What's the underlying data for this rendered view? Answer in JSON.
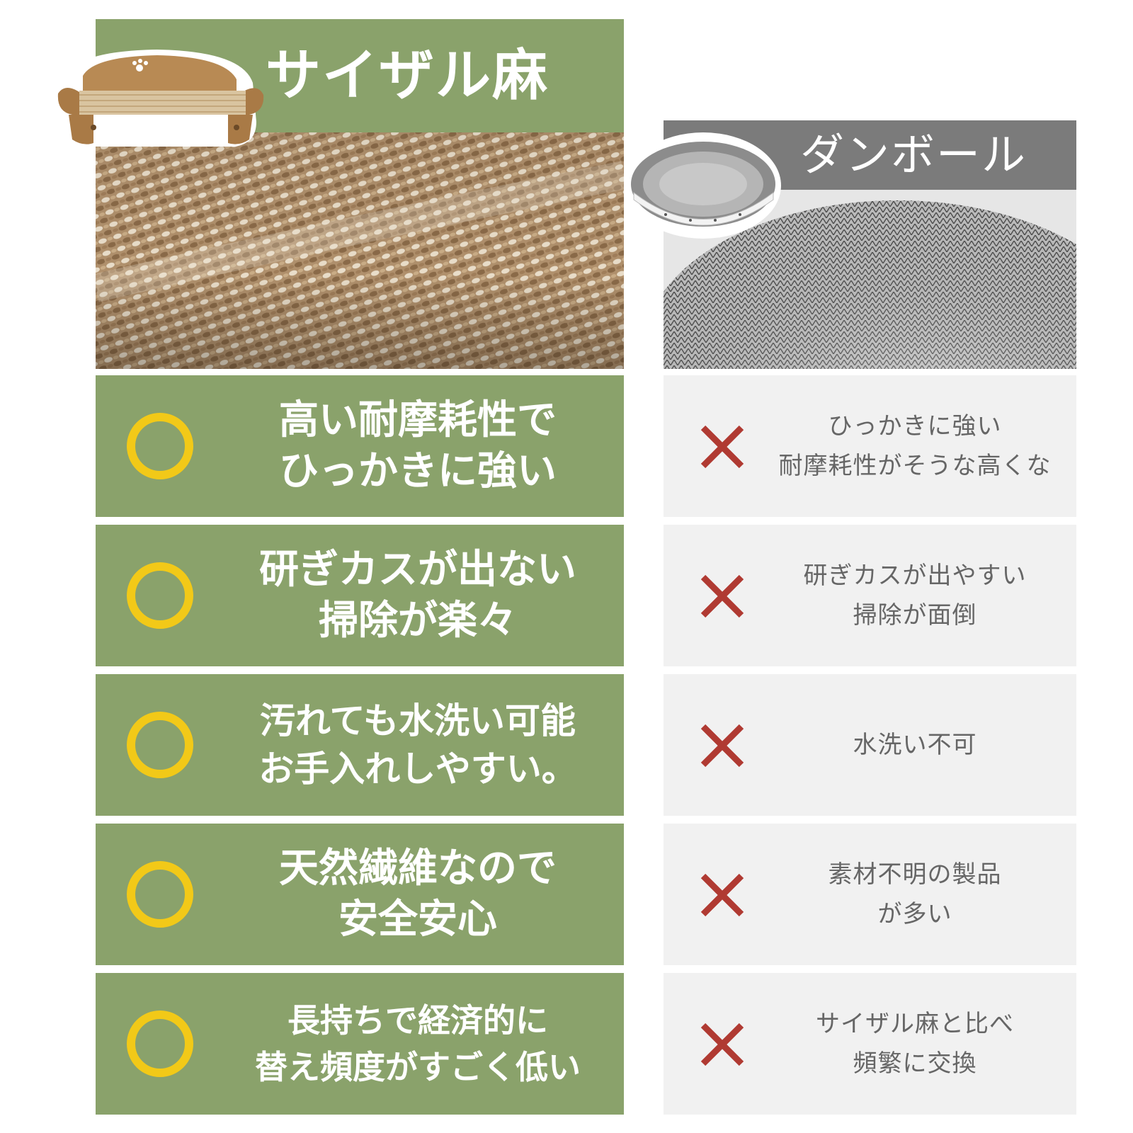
{
  "colors": {
    "sisal_green": "#8aa26b",
    "cardboard_gray": "#7b7b7b",
    "row_gray": "#f1f1f1",
    "good_mark": "#f2c918",
    "bad_mark": "#b03a32"
  },
  "sisal": {
    "title": "サイザル麻"
  },
  "cardboard": {
    "title": "ダンボール"
  },
  "rows": [
    {
      "good_line1": "高い耐摩耗性で",
      "good_line2": "ひっかきに強い",
      "bad_line1": "ひっかきに強い",
      "bad_line2": "耐摩耗性がそうな高くな"
    },
    {
      "good_line1": "研ぎカスが出ない",
      "good_line2": "掃除が楽々",
      "bad_line1": "研ぎカスが出やすい",
      "bad_line2": "掃除が面倒"
    },
    {
      "good_line1": "汚れても水洗い可能",
      "good_line2": "お手入れしやすい。",
      "bad_line1": "水洗い不可",
      "bad_line2": ""
    },
    {
      "good_line1": "天然繊維なので",
      "good_line2": "安全安心",
      "bad_line1": "素材不明の製品",
      "bad_line2": "が多い"
    },
    {
      "good_line1": "長持ちで経済的に",
      "good_line2": "替え頻度がすごく低い",
      "bad_line1": "サイザル麻と比べ",
      "bad_line2": "頻繁に交換"
    }
  ]
}
